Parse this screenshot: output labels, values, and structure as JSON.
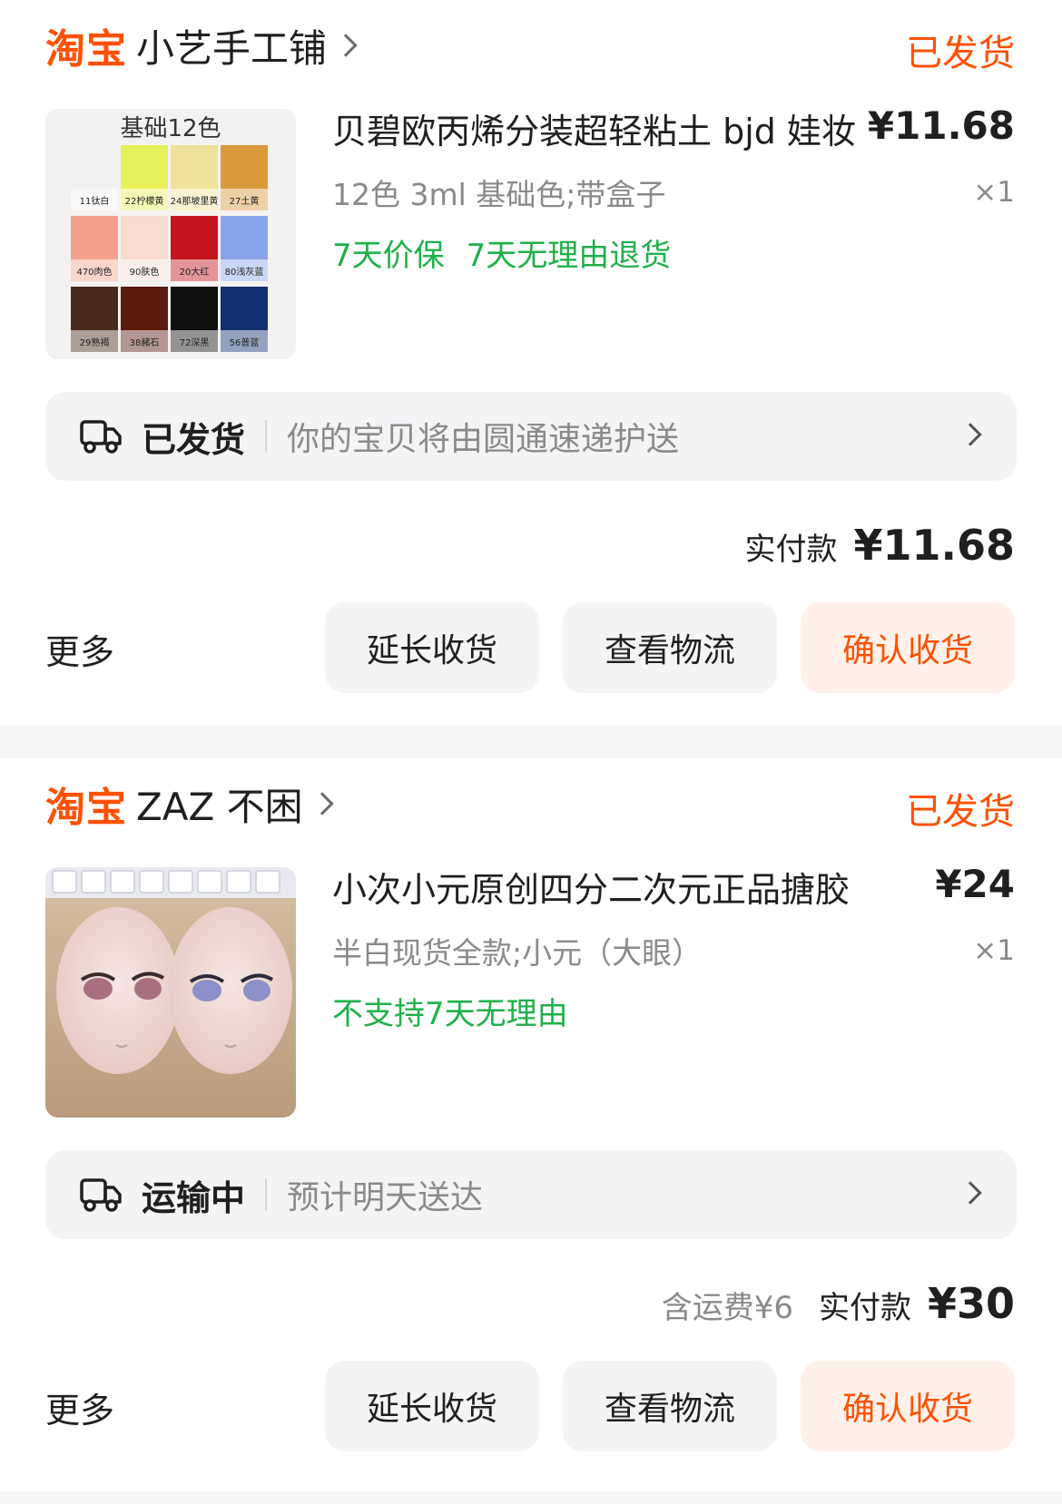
{
  "orders": [
    {
      "logo": "淘宝",
      "shop": "小艺手工铺",
      "status": "已发货",
      "product": {
        "title": "贝碧欧丙烯分装超轻粘土 bjd 娃妆",
        "price": "¥11.68",
        "sku": "12色 3ml 基础色;带盒子",
        "qty": "×1",
        "tags": [
          "7天价保",
          "7天无理由退货"
        ],
        "image_caption": "基础12色",
        "swatches": [
          {
            "label": "11钛白",
            "color": "#f2f2f0"
          },
          {
            "label": "22柠檬黄",
            "color": "#e6f05a"
          },
          {
            "label": "24那坡里黄",
            "color": "#f0e29a"
          },
          {
            "label": "27土黄",
            "color": "#d89a3a"
          },
          {
            "label": "470肉色",
            "color": "#f4a28e"
          },
          {
            "label": "90肤色",
            "color": "#f8dccf"
          },
          {
            "label": "20大红",
            "color": "#c4141e"
          },
          {
            "label": "80浅灰蓝",
            "color": "#8aa4ea"
          },
          {
            "label": "29熟褐",
            "color": "#4a2a1a"
          },
          {
            "label": "38赭石",
            "color": "#5a1a0e"
          },
          {
            "label": "72深黑",
            "color": "#101010"
          },
          {
            "label": "56普蓝",
            "color": "#123070"
          }
        ]
      },
      "shipping": {
        "status": "已发货",
        "text": "你的宝贝将由圆通速递护送"
      },
      "payment": {
        "fee": "",
        "label": "实付款",
        "amount": "¥11.68"
      },
      "actions": {
        "more": "更多",
        "extend": "延长收货",
        "logistics": "查看物流",
        "confirm": "确认收货"
      }
    },
    {
      "logo": "淘宝",
      "shop": "ZAZ 不困",
      "status": "已发货",
      "product": {
        "title": "小次小元原创四分二次元正品搪胶",
        "price": "¥24",
        "sku": "半白现货全款;小元（大眼）",
        "qty": "×1",
        "tags": [
          "不支持7天无理由"
        ]
      },
      "shipping": {
        "status": "运输中",
        "text": "预计明天送达"
      },
      "payment": {
        "fee": "含运费¥6",
        "label": "实付款",
        "amount": "¥30"
      },
      "actions": {
        "more": "更多",
        "extend": "延长收货",
        "logistics": "查看物流",
        "confirm": "确认收货"
      }
    }
  ]
}
